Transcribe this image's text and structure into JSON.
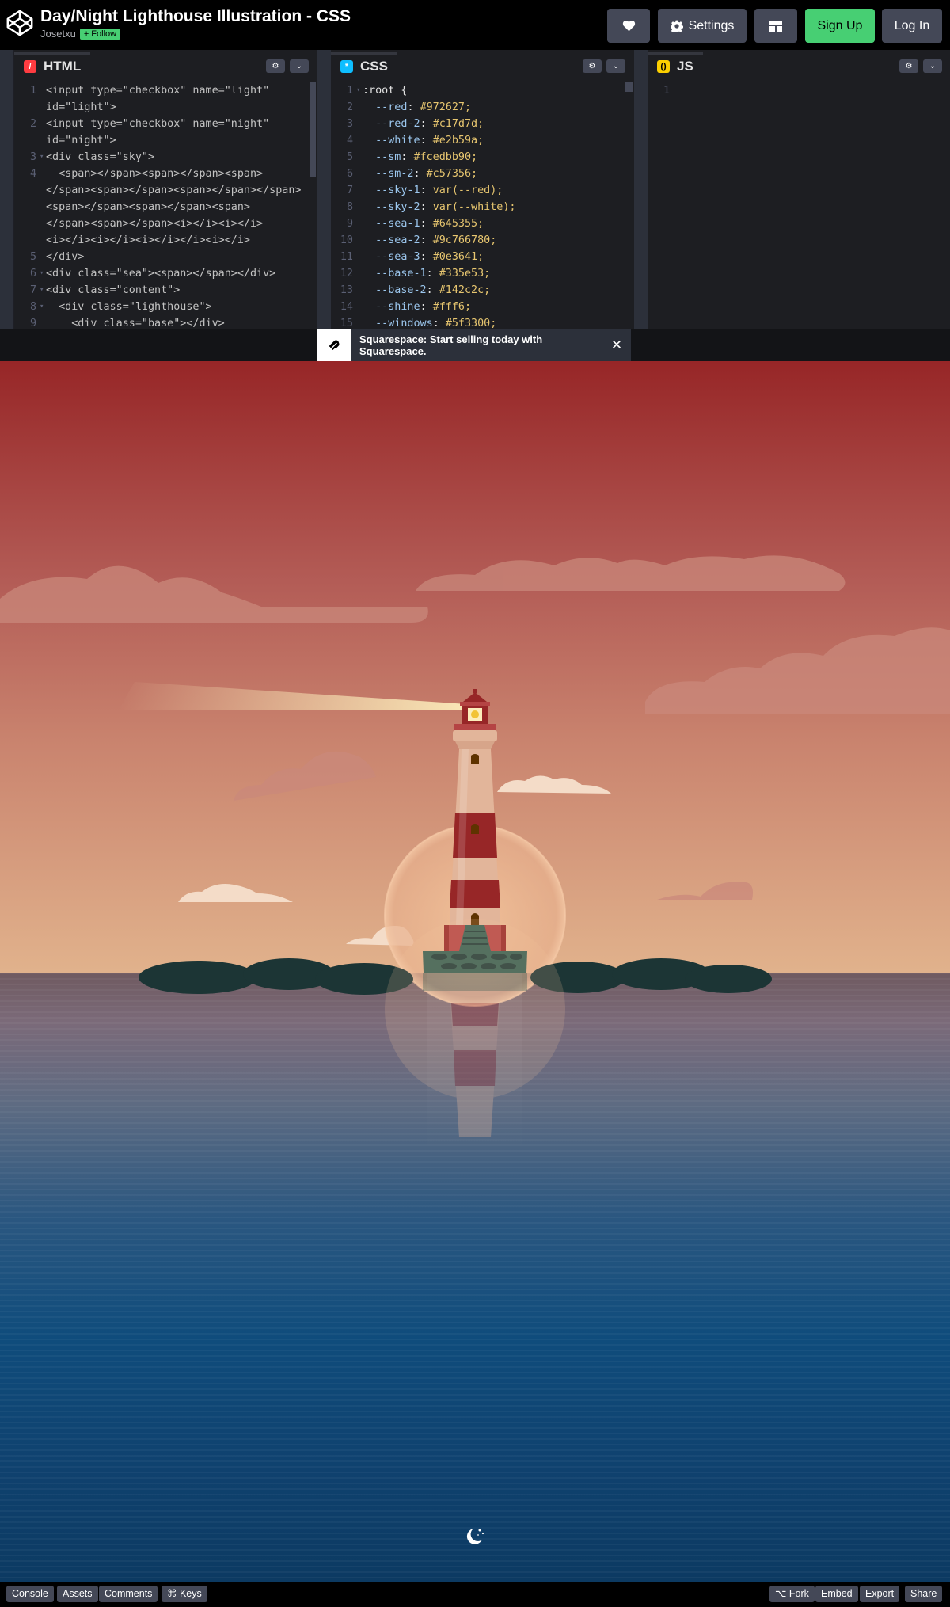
{
  "header": {
    "title": "Day/Night Lighthouse Illustration - CSS",
    "author": "Josetxu",
    "follow_label": "Follow",
    "follow_icon": "plus-icon",
    "settings_label": "Settings",
    "signup_label": "Sign Up",
    "login_label": "Log In"
  },
  "editors": {
    "html": {
      "tab_label": "HTML",
      "lines": [
        {
          "n": "1",
          "fold": "",
          "code": "<input type=\"checkbox\" name=\"light\""
        },
        {
          "n": "",
          "fold": "",
          "code": "id=\"light\">"
        },
        {
          "n": "2",
          "fold": "",
          "code": "<input type=\"checkbox\" name=\"night\""
        },
        {
          "n": "",
          "fold": "",
          "code": "id=\"night\">"
        },
        {
          "n": "3",
          "fold": "▾",
          "code": "<div class=\"sky\">"
        },
        {
          "n": "4",
          "fold": "",
          "code": "  <span></span><span></span><span>"
        },
        {
          "n": "",
          "fold": "",
          "code": "</span><span></span><span></span></span>"
        },
        {
          "n": "",
          "fold": "",
          "code": "<span></span><span></span><span>"
        },
        {
          "n": "",
          "fold": "",
          "code": "</span><span></span><i></i><i></i>"
        },
        {
          "n": "",
          "fold": "",
          "code": "<i></i><i></i><i></i></i><i></i>"
        },
        {
          "n": "5",
          "fold": "",
          "code": "</div>"
        },
        {
          "n": "6",
          "fold": "▾",
          "code": "<div class=\"sea\"><span></span></div>"
        },
        {
          "n": "7",
          "fold": "▾",
          "code": "<div class=\"content\">"
        },
        {
          "n": "8",
          "fold": "▾",
          "code": "  <div class=\"lighthouse\">"
        },
        {
          "n": "9",
          "fold": "",
          "code": "    <div class=\"base\"></div>"
        }
      ]
    },
    "css": {
      "tab_label": "CSS",
      "lines": [
        {
          "n": "1",
          "fold": "▾",
          "prop": ":root {",
          "val": ""
        },
        {
          "n": "2",
          "fold": "",
          "prop": "  --red",
          "val": "#972627;"
        },
        {
          "n": "3",
          "fold": "",
          "prop": "  --red-2",
          "val": "#c17d7d;"
        },
        {
          "n": "4",
          "fold": "",
          "prop": "  --white",
          "val": "#e2b59a;"
        },
        {
          "n": "5",
          "fold": "",
          "prop": "  --sm",
          "val": "#fcedbb90;"
        },
        {
          "n": "6",
          "fold": "",
          "prop": "  --sm-2",
          "val": "#c57356;"
        },
        {
          "n": "7",
          "fold": "",
          "prop": "  --sky-1",
          "val": "var(--red);"
        },
        {
          "n": "8",
          "fold": "",
          "prop": "  --sky-2",
          "val": "var(--white);"
        },
        {
          "n": "9",
          "fold": "",
          "prop": "  --sea-1",
          "val": "#645355;"
        },
        {
          "n": "10",
          "fold": "",
          "prop": "  --sea-2",
          "val": "#9c766780;"
        },
        {
          "n": "11",
          "fold": "",
          "prop": "  --sea-3",
          "val": "#0e3641;"
        },
        {
          "n": "12",
          "fold": "",
          "prop": "  --base-1",
          "val": "#335e53;"
        },
        {
          "n": "13",
          "fold": "",
          "prop": "  --base-2",
          "val": "#142c2c;"
        },
        {
          "n": "14",
          "fold": "",
          "prop": "  --shine",
          "val": "#fff6;"
        },
        {
          "n": "15",
          "fold": "",
          "prop": "  --windows",
          "val": "#5f3300;"
        }
      ]
    },
    "js": {
      "tab_label": "JS",
      "lines": [
        {
          "n": "1",
          "fold": "",
          "code": ""
        }
      ]
    }
  },
  "ad": {
    "text": "Squarespace: Start selling today with Squarespace.",
    "close_label": "✕"
  },
  "preview": {
    "toggle_icon": "moon-stars-icon"
  },
  "footer": {
    "console_label": "Console",
    "assets_label": "Assets",
    "comments_label": "Comments",
    "keys_label": "⌘ Keys",
    "fork_label": "⌥ Fork",
    "embed_label": "Embed",
    "export_label": "Export",
    "share_label": "Share"
  },
  "colors": {
    "header_bg": "#000000",
    "signup_green": "#47cf73",
    "button_gray": "#444857",
    "html_badge": "#ff3c41",
    "css_badge": "#0ebeff",
    "js_badge": "#fcd000",
    "lighthouse_red": "#972627",
    "lighthouse_white": "#e2b59a"
  }
}
